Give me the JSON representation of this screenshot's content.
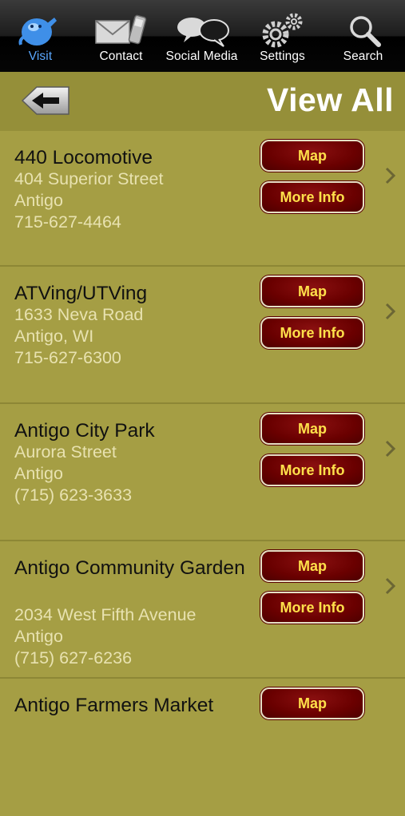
{
  "tabbar": {
    "tabs": [
      {
        "label": "Visit",
        "icon": "visit-mascot-icon",
        "active": true
      },
      {
        "label": "Contact",
        "icon": "envelope-phone-icon",
        "active": false
      },
      {
        "label": "Social Media",
        "icon": "speech-bubbles-icon",
        "active": false
      },
      {
        "label": "Settings",
        "icon": "gears-icon",
        "active": false
      },
      {
        "label": "Search",
        "icon": "magnifier-icon",
        "active": false
      }
    ]
  },
  "header": {
    "title": "View All",
    "back_icon": "back-arrow-icon"
  },
  "buttons": {
    "map": "Map",
    "more_info": "More Info"
  },
  "listings": [
    {
      "name": "440 Locomotive",
      "line1": "404 Superior Street",
      "line2": "Antigo",
      "line3": "715-627-4464"
    },
    {
      "name": "ATVing/UTVing",
      "line1": "1633 Neva Road",
      "line2": "Antigo, WI",
      "line3": "715-627-6300"
    },
    {
      "name": "Antigo City Park",
      "line1": "Aurora Street",
      "line2": "Antigo",
      "line3": "(715) 623-3633"
    },
    {
      "name": "Antigo Community Garden",
      "line1": "2034 West Fifth Avenue",
      "line2": "Antigo",
      "line3": "(715) 627-6236"
    },
    {
      "name": "Antigo Farmers Market"
    }
  ],
  "colors": {
    "background": "#a59e44",
    "header": "#958f39",
    "button": "#6a0000",
    "button_text": "#ffe04a",
    "active_tab": "#5aa8ff"
  }
}
